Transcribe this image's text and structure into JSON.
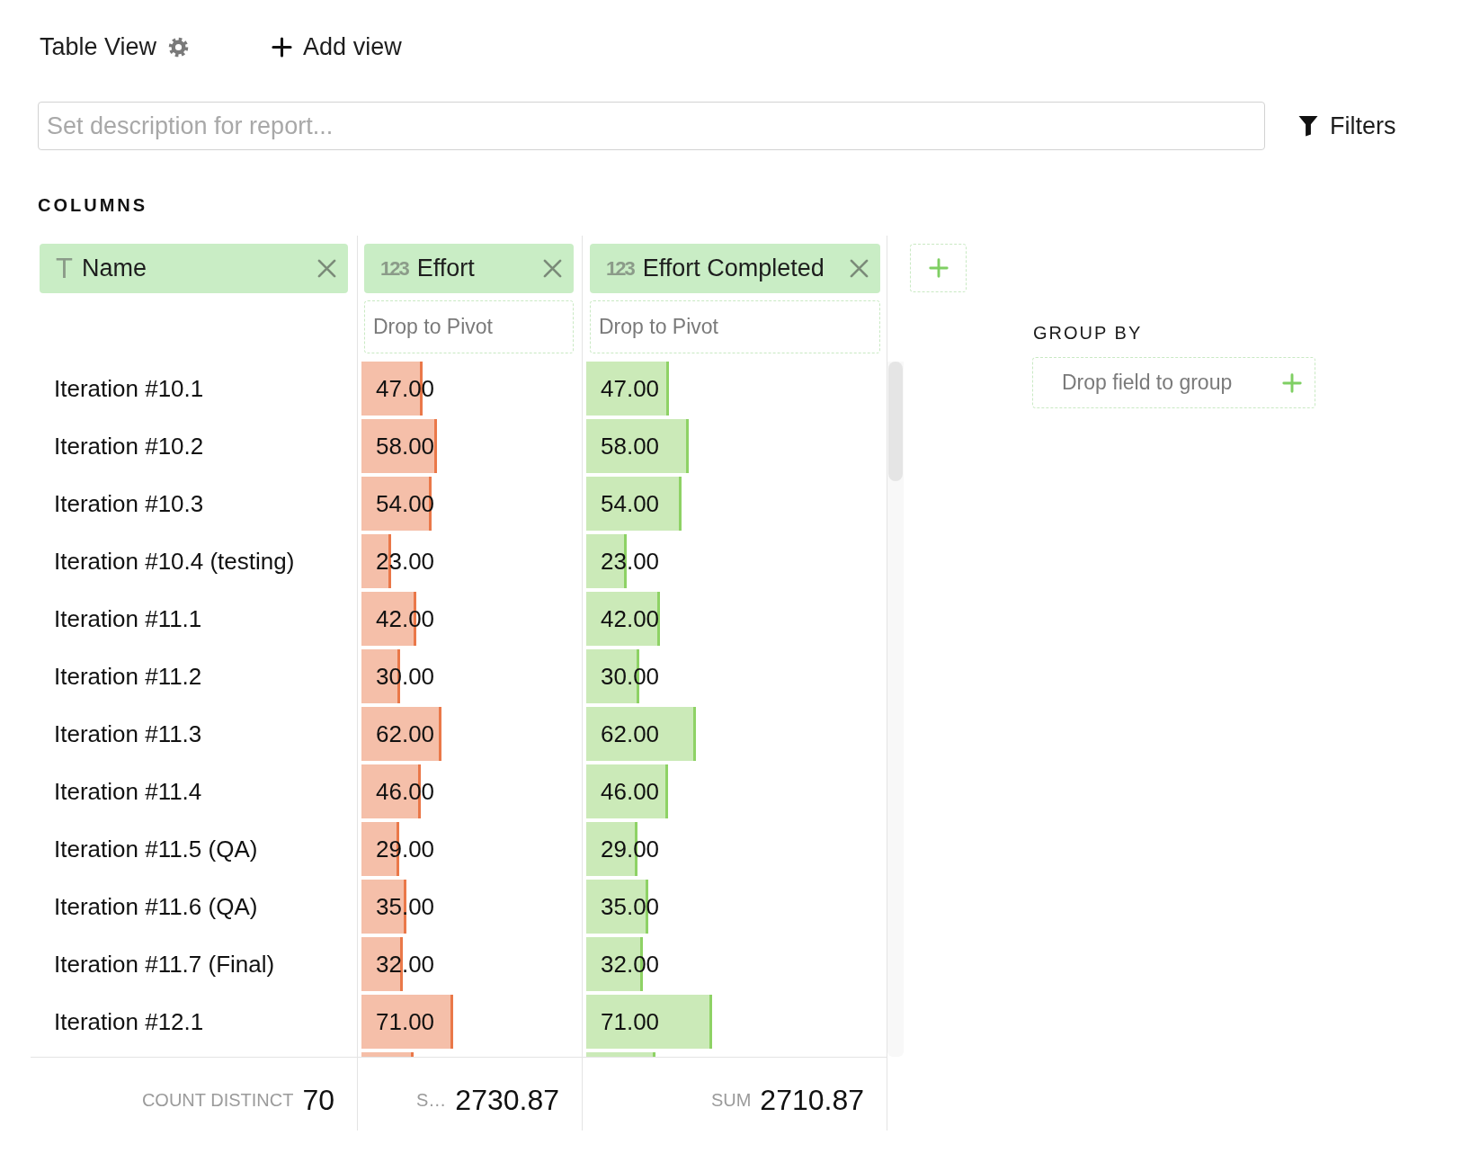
{
  "view_bar": {
    "view_title": "Table View",
    "add_view_label": "Add view"
  },
  "description_field": {
    "placeholder": "Set description for report..."
  },
  "filters_button": {
    "label": "Filters"
  },
  "columns_heading": "COLUMNS",
  "table": {
    "columns": [
      {
        "kind": "text",
        "type_glyph": "T",
        "name": "Name"
      },
      {
        "kind": "number",
        "type_glyph": "123",
        "name": "Effort",
        "pivot_placeholder": "Drop to Pivot",
        "color": "#f5bfa9"
      },
      {
        "kind": "number",
        "type_glyph": "123",
        "name": "Effort Completed",
        "pivot_placeholder": "Drop to Pivot",
        "color": "#cbeab8"
      }
    ],
    "rows": [
      {
        "cells": [
          {
            "text": "Iteration #10.1"
          },
          {
            "text": "47.00",
            "level": 0.276
          },
          {
            "text": "47.00",
            "level": 0.276
          }
        ]
      },
      {
        "cells": [
          {
            "text": "Iteration #10.2"
          },
          {
            "text": "58.00",
            "level": 0.341
          },
          {
            "text": "58.00",
            "level": 0.341
          }
        ]
      },
      {
        "cells": [
          {
            "text": "Iteration #10.3"
          },
          {
            "text": "54.00",
            "level": 0.318
          },
          {
            "text": "54.00",
            "level": 0.318
          }
        ]
      },
      {
        "cells": [
          {
            "text": "Iteration #10.4 (testing)"
          },
          {
            "text": "23.00",
            "level": 0.135
          },
          {
            "text": "23.00",
            "level": 0.135
          }
        ]
      },
      {
        "cells": [
          {
            "text": "Iteration #11.1"
          },
          {
            "text": "42.00",
            "level": 0.247
          },
          {
            "text": "42.00",
            "level": 0.247
          }
        ]
      },
      {
        "cells": [
          {
            "text": "Iteration #11.2"
          },
          {
            "text": "30.00",
            "level": 0.176
          },
          {
            "text": "30.00",
            "level": 0.176
          }
        ]
      },
      {
        "cells": [
          {
            "text": "Iteration #11.3"
          },
          {
            "text": "62.00",
            "level": 0.365
          },
          {
            "text": "62.00",
            "level": 0.365
          }
        ]
      },
      {
        "cells": [
          {
            "text": "Iteration #11.4"
          },
          {
            "text": "46.00",
            "level": 0.271
          },
          {
            "text": "46.00",
            "level": 0.271
          }
        ]
      },
      {
        "cells": [
          {
            "text": "Iteration #11.5 (QA)"
          },
          {
            "text": "29.00",
            "level": 0.171
          },
          {
            "text": "29.00",
            "level": 0.171
          }
        ]
      },
      {
        "cells": [
          {
            "text": "Iteration #11.6 (QA)"
          },
          {
            "text": "35.00",
            "level": 0.206
          },
          {
            "text": "35.00",
            "level": 0.206
          }
        ]
      },
      {
        "cells": [
          {
            "text": "Iteration #11.7 (Final)"
          },
          {
            "text": "32.00",
            "level": 0.188
          },
          {
            "text": "32.00",
            "level": 0.188
          }
        ]
      },
      {
        "cells": [
          {
            "text": "Iteration #12.1"
          },
          {
            "text": "71.00",
            "level": 0.418
          },
          {
            "text": "71.00",
            "level": 0.418
          }
        ]
      },
      {
        "cells": [
          null,
          {
            "level": 0.235
          },
          {
            "level": 0.231
          }
        ]
      }
    ],
    "footer": [
      {
        "aggregate_label": "COUNT DISTINCT",
        "aggregate_value": "70"
      },
      {
        "aggregate_label": "S…",
        "aggregate_value": "2730.87"
      },
      {
        "aggregate_label": "SUM",
        "aggregate_value": "2710.87"
      }
    ]
  },
  "group_by": {
    "heading": "GROUP BY",
    "drop_hint": "Drop field to group"
  }
}
